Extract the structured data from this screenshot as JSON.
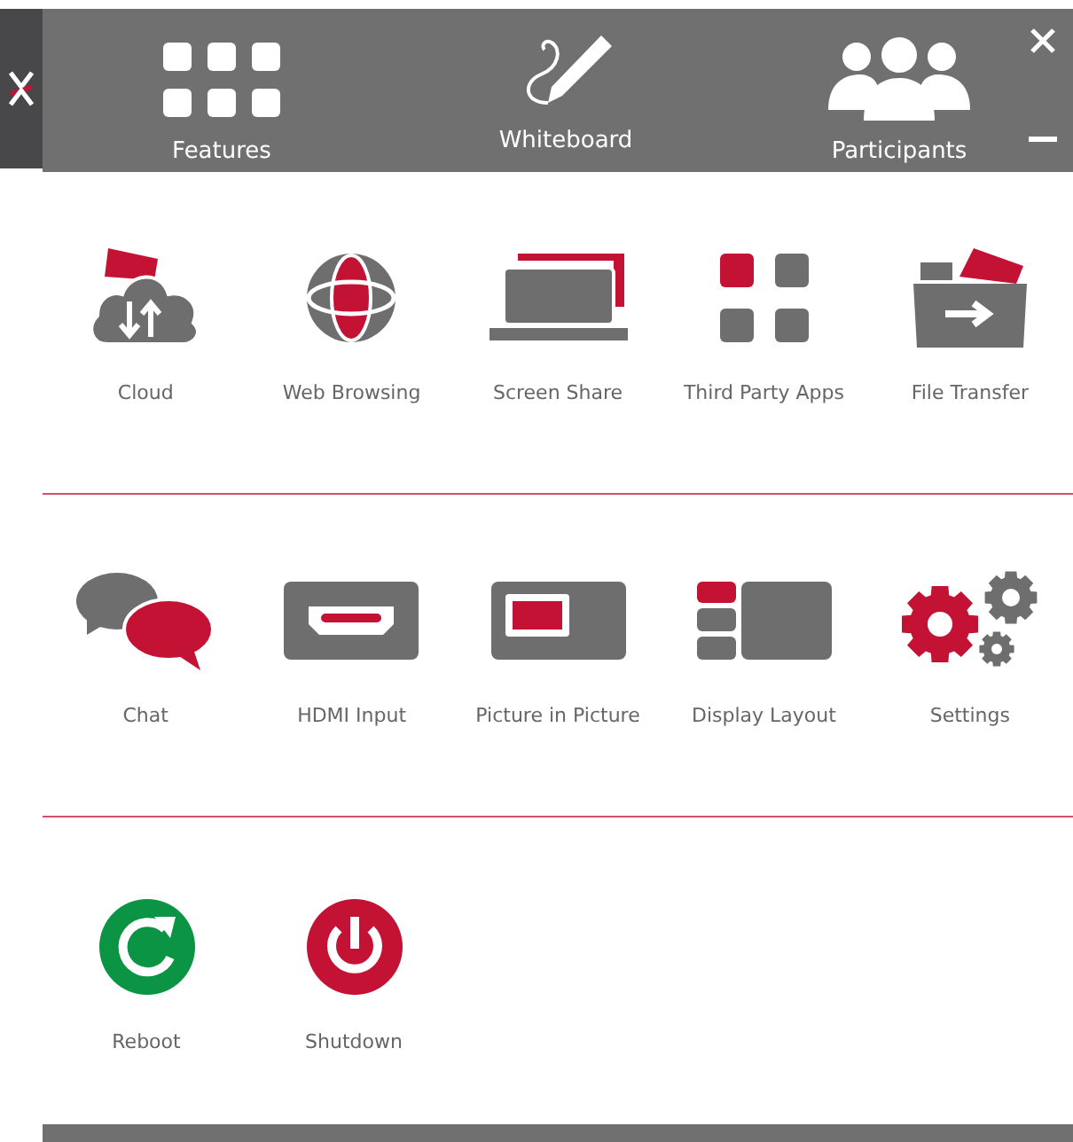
{
  "header": {
    "items": [
      {
        "label": "Features"
      },
      {
        "label": "Whiteboard"
      },
      {
        "label": "Participants"
      }
    ]
  },
  "sections": [
    {
      "tiles": [
        {
          "label": "Cloud"
        },
        {
          "label": "Web Browsing"
        },
        {
          "label": "Screen Share"
        },
        {
          "label": "Third Party Apps"
        },
        {
          "label": "File Transfer"
        }
      ]
    },
    {
      "tiles": [
        {
          "label": "Chat"
        },
        {
          "label": "HDMI Input"
        },
        {
          "label": "Picture in Picture"
        },
        {
          "label": "Display Layout"
        },
        {
          "label": "Settings"
        }
      ]
    },
    {
      "tiles": [
        {
          "label": "Reboot"
        },
        {
          "label": "Shutdown"
        }
      ]
    }
  ]
}
